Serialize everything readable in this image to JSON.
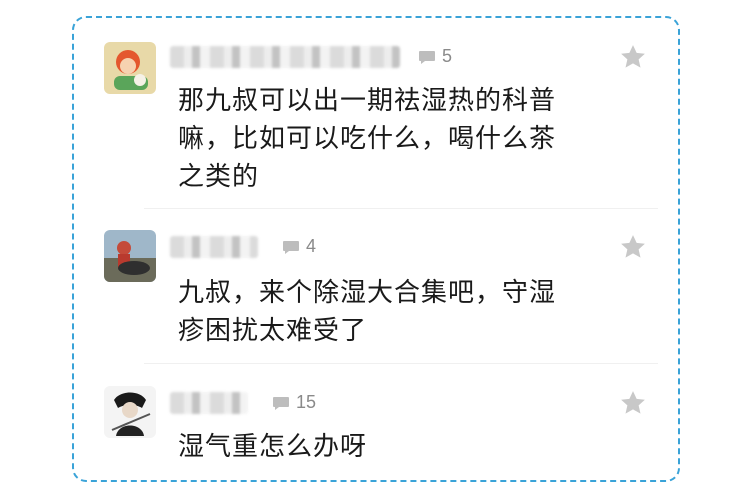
{
  "comments": [
    {
      "reply_count": "5",
      "text_lines": [
        "那九叔可以出一期祛湿热的科普",
        "嘛，比如可以吃什么，喝什么茶",
        "之类的"
      ]
    },
    {
      "reply_count": "4",
      "text_lines": [
        "九叔，来个除湿大合集吧，守湿",
        "疹困扰太难受了"
      ]
    },
    {
      "reply_count": "15",
      "text_lines": [
        "湿气重怎么办呀"
      ]
    }
  ],
  "colors": {
    "border": "#3aa3d8",
    "star": "#c8c8c8",
    "reply": "#8a8a8a",
    "text": "#1a1a1a"
  },
  "icons": {
    "reply": "comment-bubble-icon",
    "favorite": "star-icon"
  }
}
